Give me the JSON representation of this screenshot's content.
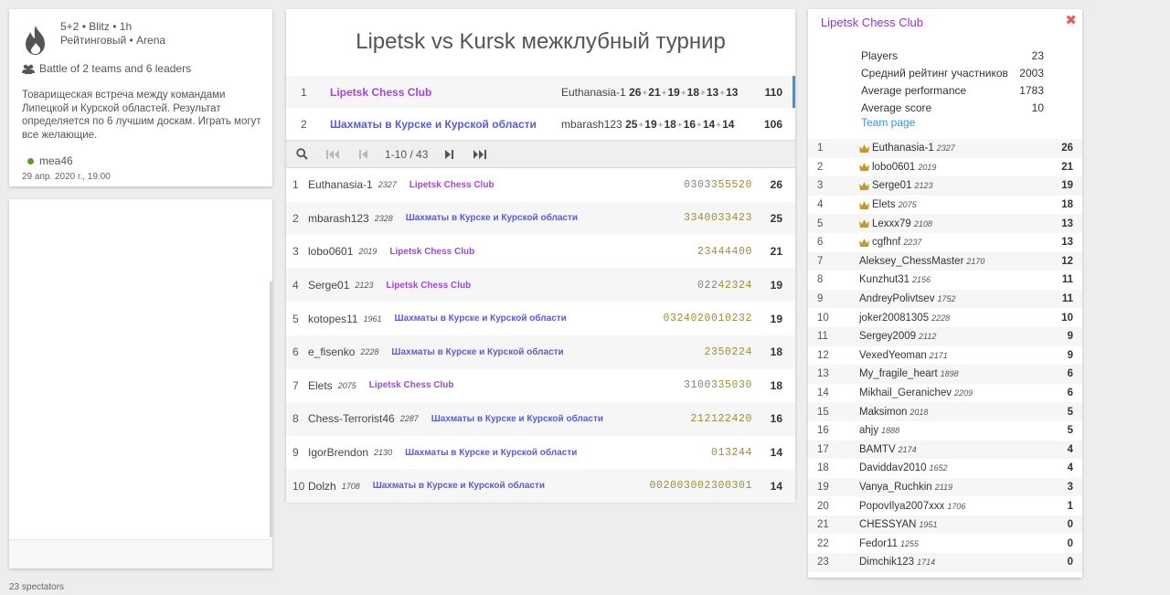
{
  "colors": {
    "team1": "#a247d8",
    "team2": "#5b5bd6",
    "accent": "#3893e8"
  },
  "info": {
    "clock_line": "5+2 • Blitz • 1h",
    "mode_line": "Рейтинговый • Arena",
    "teams_line": "Battle of 2 teams and 6 leaders",
    "description": "Товарищеская встреча между командами Липецкой и Курской областей. Результат определяется по 6 лучшим доскам. Играть могут все желающие.",
    "creator": "mea46",
    "date": "29 апр. 2020 г., 19:00"
  },
  "spectators": "23 spectators",
  "title": "Lipetsk vs Kursk межклубный турнир",
  "teams": [
    {
      "rank": "1",
      "name": "Lipetsk Chess Club",
      "leader": "Euthanasia-1",
      "parts": [
        "26",
        "21",
        "19",
        "18",
        "13",
        "13"
      ],
      "score": "110"
    },
    {
      "rank": "2",
      "name": "Шахматы в Курске и Курской области",
      "leader": "mbarash123",
      "parts": [
        "25",
        "19",
        "18",
        "16",
        "14",
        "14"
      ],
      "score": "106"
    }
  ],
  "pager": {
    "text": "1-10 / 43"
  },
  "players": [
    {
      "rank": "1",
      "name": "Euthanasia-1",
      "rating": "2327",
      "team": "Lipetsk Chess Club",
      "team_id": 1,
      "sheet": "0303355520",
      "hl_from": 4,
      "score": "26"
    },
    {
      "rank": "2",
      "name": "mbarash123",
      "rating": "2328",
      "team": "Шахматы в Курске и Курской области",
      "team_id": 2,
      "sheet": "3340033423",
      "hl_from": 0,
      "score": "25"
    },
    {
      "rank": "3",
      "name": "lobo0601",
      "rating": "2019",
      "team": "Lipetsk Chess Club",
      "team_id": 1,
      "sheet": "23444400",
      "hl_from": 99,
      "score": "21"
    },
    {
      "rank": "4",
      "name": "Serge01",
      "rating": "2123",
      "team": "Lipetsk Chess Club",
      "team_id": 1,
      "sheet": "02242324",
      "hl_from": 3,
      "score": "19"
    },
    {
      "rank": "5",
      "name": "kotopes11",
      "rating": "1961",
      "team": "Шахматы в Курске и Курской области",
      "team_id": 2,
      "sheet": "0324020010232",
      "hl_from": 99,
      "score": "19"
    },
    {
      "rank": "6",
      "name": "e_fisenko",
      "rating": "2228",
      "team": "Шахматы в Курске и Курской области",
      "team_id": 2,
      "sheet": "2350224",
      "hl_from": 0,
      "score": "18"
    },
    {
      "rank": "7",
      "name": "Elets",
      "rating": "2075",
      "team": "Lipetsk Chess Club",
      "team_id": 1,
      "sheet": "3100335030",
      "hl_from": 4,
      "score": "18"
    },
    {
      "rank": "8",
      "name": "Chess-Terrorist46",
      "rating": "2287",
      "team": "Шахматы в Курске и Курской области",
      "team_id": 2,
      "sheet": "212122420",
      "hl_from": 99,
      "score": "16"
    },
    {
      "rank": "9",
      "name": "IgorBrendon",
      "rating": "2130",
      "team": "Шахматы в Курске и Курской области",
      "team_id": 2,
      "sheet": "013244",
      "hl_from": 99,
      "score": "14"
    },
    {
      "rank": "10",
      "name": "Dolzh",
      "rating": "1708",
      "team": "Шахматы в Курске и Курской области",
      "team_id": 2,
      "sheet": "002003002300301",
      "hl_from": 99,
      "score": "14"
    }
  ],
  "club": {
    "title": "Lipetsk Chess Club",
    "stats": [
      {
        "label": "Players",
        "value": "23"
      },
      {
        "label": "Средний рейтинг участников",
        "value": "2003"
      },
      {
        "label": "Average performance",
        "value": "1783"
      },
      {
        "label": "Average score",
        "value": "10"
      }
    ],
    "team_page": "Team page",
    "members": [
      {
        "rank": "1",
        "name": "Euthanasia-1",
        "rating": "2327",
        "score": "26",
        "leader": true
      },
      {
        "rank": "2",
        "name": "lobo0601",
        "rating": "2019",
        "score": "21",
        "leader": true
      },
      {
        "rank": "3",
        "name": "Serge01",
        "rating": "2123",
        "score": "19",
        "leader": true
      },
      {
        "rank": "4",
        "name": "Elets",
        "rating": "2075",
        "score": "18",
        "leader": true
      },
      {
        "rank": "5",
        "name": "Lexxx79",
        "rating": "2108",
        "score": "13",
        "leader": true
      },
      {
        "rank": "6",
        "name": "cgfhnf",
        "rating": "2237",
        "score": "13",
        "leader": true
      },
      {
        "rank": "7",
        "name": "Aleksey_ChessMaster",
        "rating": "2170",
        "score": "12",
        "leader": false
      },
      {
        "rank": "8",
        "name": "Kunzhut31",
        "rating": "2156",
        "score": "11",
        "leader": false
      },
      {
        "rank": "9",
        "name": "AndreyPolivtsev",
        "rating": "1752",
        "score": "11",
        "leader": false
      },
      {
        "rank": "10",
        "name": "joker20081305",
        "rating": "2228",
        "score": "10",
        "leader": false
      },
      {
        "rank": "11",
        "name": "Sergey2009",
        "rating": "2112",
        "score": "9",
        "leader": false
      },
      {
        "rank": "12",
        "name": "VexedYeoman",
        "rating": "2171",
        "score": "9",
        "leader": false
      },
      {
        "rank": "13",
        "name": "My_fragile_heart",
        "rating": "1898",
        "score": "6",
        "leader": false
      },
      {
        "rank": "14",
        "name": "Mikhail_Geranichev",
        "rating": "2209",
        "score": "6",
        "leader": false
      },
      {
        "rank": "15",
        "name": "Maksimon",
        "rating": "2018",
        "score": "5",
        "leader": false
      },
      {
        "rank": "16",
        "name": "ahjy",
        "rating": "1888",
        "score": "5",
        "leader": false
      },
      {
        "rank": "17",
        "name": "BAMTV",
        "rating": "2174",
        "score": "4",
        "leader": false
      },
      {
        "rank": "18",
        "name": "Daviddav2010",
        "rating": "1652",
        "score": "4",
        "leader": false
      },
      {
        "rank": "19",
        "name": "Vanya_Ruchkin",
        "rating": "2119",
        "score": "3",
        "leader": false
      },
      {
        "rank": "20",
        "name": "PopovIlya2007xxx",
        "rating": "1706",
        "score": "1",
        "leader": false
      },
      {
        "rank": "21",
        "name": "CHESSYAN",
        "rating": "1951",
        "score": "0",
        "leader": false
      },
      {
        "rank": "22",
        "name": "Fedor11",
        "rating": "1255",
        "score": "0",
        "leader": false
      },
      {
        "rank": "23",
        "name": "Dimchik123",
        "rating": "1714",
        "score": "0",
        "leader": false
      }
    ]
  }
}
